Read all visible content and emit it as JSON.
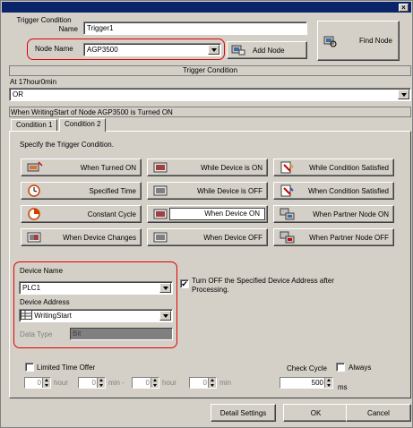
{
  "window": {
    "close_glyph": "×"
  },
  "trigger_condition_name": {
    "label_line1": "Trigger Condition",
    "label_line2": "Name",
    "value": "Trigger1"
  },
  "node_name": {
    "label": "Node Name",
    "value": "AGP3500"
  },
  "buttons": {
    "add_node": "Add Node",
    "find_node": "Find Node",
    "detail_settings": "Detail Settings",
    "ok": "OK",
    "cancel": "Cancel"
  },
  "trigger_condition_header": "Trigger Condition",
  "summary_line1": "At 17hour0min",
  "summary_operator": "OR",
  "summary_line2": "When WritingStart of Node AGP3500 is Turned ON",
  "tabs": [
    "Condition 1",
    "Condition 2"
  ],
  "specify_text": "Specify the Trigger Condition.",
  "conditions": [
    [
      "When Turned ON",
      "While Device is ON",
      "While Condition Satisfied"
    ],
    [
      "Specified Time",
      "While Device is OFF",
      "When Condition Satisfied"
    ],
    [
      "Constant Cycle",
      "When Device ON",
      "When Partner Node ON"
    ],
    [
      "When Device Changes",
      "When Device OFF",
      "When Partner Node OFF"
    ]
  ],
  "device": {
    "name_label": "Device Name",
    "name_value": "PLC1",
    "address_label": "Device Address",
    "address_value": "WritingStart",
    "data_type_label": "Data Type",
    "data_type_value": "Bit",
    "turn_off_line1": "Turn OFF the Specified Device Address after",
    "turn_off_line2": "Processing.",
    "check_mark": "✔"
  },
  "limited_time": {
    "label": "Limited Time Offer",
    "from_hour": "0",
    "hour_label": "hour",
    "from_min": "0",
    "min_dash_label": "min -",
    "to_hour": "0",
    "to_min": "0",
    "min_label": "min"
  },
  "check_cycle": {
    "label": "Check Cycle",
    "always_label": "Always",
    "value": "500",
    "unit": "ms"
  },
  "colors": {
    "highlight_ring": "#e00000",
    "face": "#d4d0c8",
    "titlebar": "#0a246a"
  }
}
